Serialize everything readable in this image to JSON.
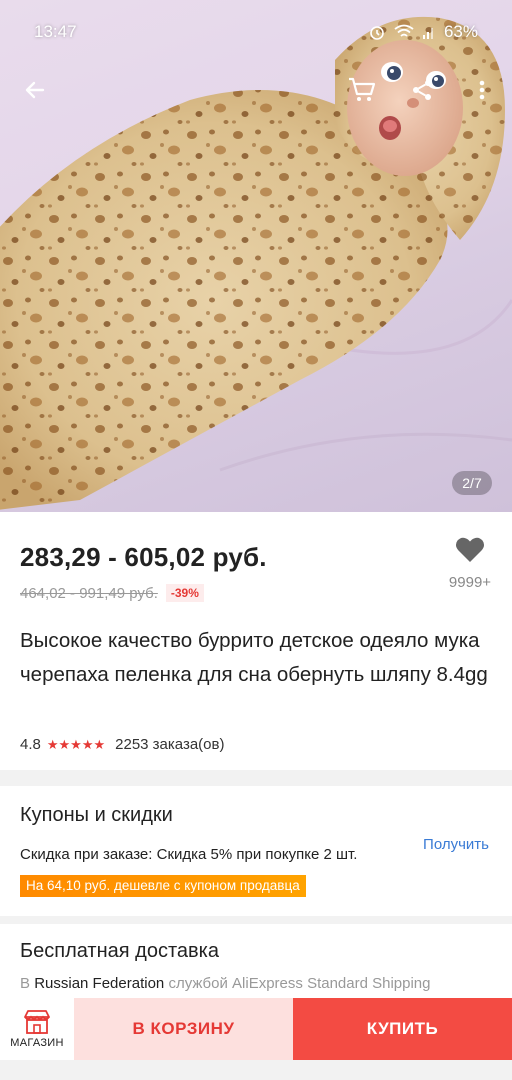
{
  "status_bar": {
    "time": "13:47",
    "battery": "63%"
  },
  "gallery": {
    "counter": "2/7"
  },
  "product": {
    "price": "283,29 - 605,02 руб.",
    "old_price": "464,02 - 991,49 руб.",
    "discount": "-39%",
    "wishlist_count": "9999+",
    "title": "Высокое качество буррито детское одеяло мука черепаха пеленка для сна обернуть шляпу 8.4gg",
    "rating": "4.8",
    "rating_stars": 4.8,
    "orders": "2253 заказа(ов)"
  },
  "coupons": {
    "title": "Купоны и скидки",
    "order_discount": "Скидка при заказе: Скидка 5% при покупке 2 шт.",
    "coupon_tag": "На 64,10 руб. дешевле с купоном продавца",
    "get_label": "Получить"
  },
  "shipping": {
    "title": "Бесплатная доставка",
    "prefix": "В",
    "country": "Russian Federation",
    "method": "службой AliExpress Standard Shipping"
  },
  "bottom": {
    "store_label": "МАГАЗИН",
    "cart_label": "В КОРЗИНУ",
    "buy_label": "КУПИТЬ"
  },
  "icons": [
    "back-arrow-icon",
    "cart-icon",
    "share-icon",
    "more-vert-icon",
    "heart-icon",
    "store-icon",
    "wifi-icon",
    "signal-icon",
    "alarm-icon"
  ],
  "colors": {
    "accent": "#e53935",
    "buy": "#f34b43",
    "cart_bg": "#fde0de",
    "coupon": "#ff9500",
    "link": "#3a7bd5"
  }
}
